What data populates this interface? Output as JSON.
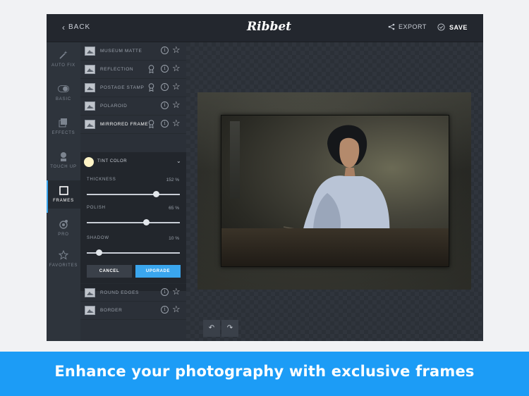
{
  "topbar": {
    "back_label": "BACK",
    "logo": "Ribbet",
    "export_label": "EXPORT",
    "save_label": "SAVE"
  },
  "nav": {
    "items": [
      {
        "label": "AUTO FIX",
        "icon": "magic-wand-icon",
        "active": false
      },
      {
        "label": "BASIC",
        "icon": "toggle-icon",
        "active": false
      },
      {
        "label": "EFFECTS",
        "icon": "effects-icon",
        "active": false
      },
      {
        "label": "TOUCH UP",
        "icon": "person-icon",
        "active": false
      },
      {
        "label": "FRAMES",
        "icon": "frame-icon",
        "active": true
      },
      {
        "label": "PRO",
        "icon": "pro-icon",
        "active": false
      },
      {
        "label": "FAVORITES",
        "icon": "star-icon",
        "active": false
      }
    ]
  },
  "frames": {
    "items": [
      {
        "name": "MUSEUM MATTE",
        "premium": false,
        "selected": false
      },
      {
        "name": "REFLECTION",
        "premium": true,
        "selected": false
      },
      {
        "name": "POSTAGE STAMP",
        "premium": true,
        "selected": false
      },
      {
        "name": "POLAROID",
        "premium": false,
        "selected": false
      },
      {
        "name": "MIRRORED FRAME",
        "premium": true,
        "selected": true
      }
    ],
    "bottom_items": [
      {
        "name": "ROUND EDGES",
        "premium": false,
        "selected": false
      },
      {
        "name": "BORDER",
        "premium": false,
        "selected": false
      }
    ]
  },
  "settings": {
    "tint_label": "TINT COLOR",
    "tint_color": "#fff4c6",
    "sliders": [
      {
        "label": "THICKNESS",
        "value_text": "152 %",
        "fraction": 0.74
      },
      {
        "label": "POLISH",
        "value_text": "65 %",
        "fraction": 0.64
      },
      {
        "label": "SHADOW",
        "value_text": "10 %",
        "fraction": 0.13
      }
    ],
    "cancel_label": "CANCEL",
    "upgrade_label": "UPGRADE"
  },
  "toolbar": {
    "undo_icon": "↶",
    "redo_icon": "↷"
  },
  "banner": {
    "text": "Enhance your photography with exclusive frames"
  },
  "colors": {
    "accent": "#3aa6ee",
    "banner": "#1c9cf6",
    "background": "#252a31"
  }
}
